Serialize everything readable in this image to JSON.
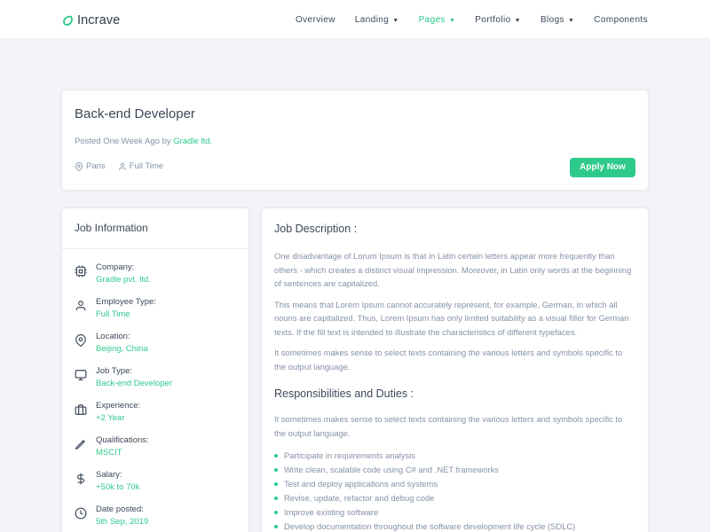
{
  "brand": {
    "name": "Incrave",
    "accent": "#2eca8b"
  },
  "nav": {
    "items": [
      {
        "label": "Overview",
        "has_dropdown": false,
        "active": false
      },
      {
        "label": "Landing",
        "has_dropdown": true,
        "active": false
      },
      {
        "label": "Pages",
        "has_dropdown": true,
        "active": true
      },
      {
        "label": "Portfolio",
        "has_dropdown": true,
        "active": false
      },
      {
        "label": "Blogs",
        "has_dropdown": true,
        "active": false
      },
      {
        "label": "Components",
        "has_dropdown": false,
        "active": false
      }
    ]
  },
  "job": {
    "title": "Back-end Developer",
    "posted_prefix": "Posted One Week Ago by",
    "company": "Gradle ltd.",
    "location": "Paris",
    "type": "Full Time",
    "apply_label": "Apply Now"
  },
  "info": {
    "heading": "Job Information",
    "items": [
      {
        "icon": "cpu-icon",
        "label": "Company:",
        "value": "Gradle pvt. ltd."
      },
      {
        "icon": "user-icon",
        "label": "Employee Type:",
        "value": "Full Time"
      },
      {
        "icon": "map-pin-icon",
        "label": "Location:",
        "value": "Beijing, China"
      },
      {
        "icon": "monitor-icon",
        "label": "Job Type:",
        "value": "Back-end Developer"
      },
      {
        "icon": "briefcase-icon",
        "label": "Experience:",
        "value": "+2 Year"
      },
      {
        "icon": "pen-tool-icon",
        "label": "Qualifications:",
        "value": "MSCIT"
      },
      {
        "icon": "dollar-sign-icon",
        "label": "Salary:",
        "value": "+50k to 70k"
      },
      {
        "icon": "clock-icon",
        "label": "Date posted:",
        "value": "5th Sep, 2019"
      }
    ]
  },
  "description": {
    "heading": "Job Description :",
    "paragraphs": [
      "One disadvantage of Lorum Ipsum is that in Latin certain letters appear more frequently than others - which creates a distinct visual impression. Moreover, in Latin only words at the beginning of sentences are capitalized.",
      "This means that Lorem Ipsum cannot accurately represent, for example, German, in which all nouns are capitalized. Thus, Lorem Ipsum has only limited suitability as a visual filler for German texts. If the fill text is intended to illustrate the characteristics of different typefaces.",
      "It sometimes makes sense to select texts containing the various letters and symbols specific to the output language."
    ],
    "responsibilities_heading": "Responsibilities and Duties :",
    "responsibilities_intro": "It sometimes makes sense to select texts containing the various letters and symbols specific to the output language.",
    "duties": [
      "Participate in requirements analysis",
      "Write clean, scalable code using C# and .NET frameworks",
      "Test and deploy applications and systems",
      "Revise, update, refactor and debug code",
      "Improve existing software",
      "Develop documentation throughout the software development life cycle (SDLC)"
    ]
  }
}
